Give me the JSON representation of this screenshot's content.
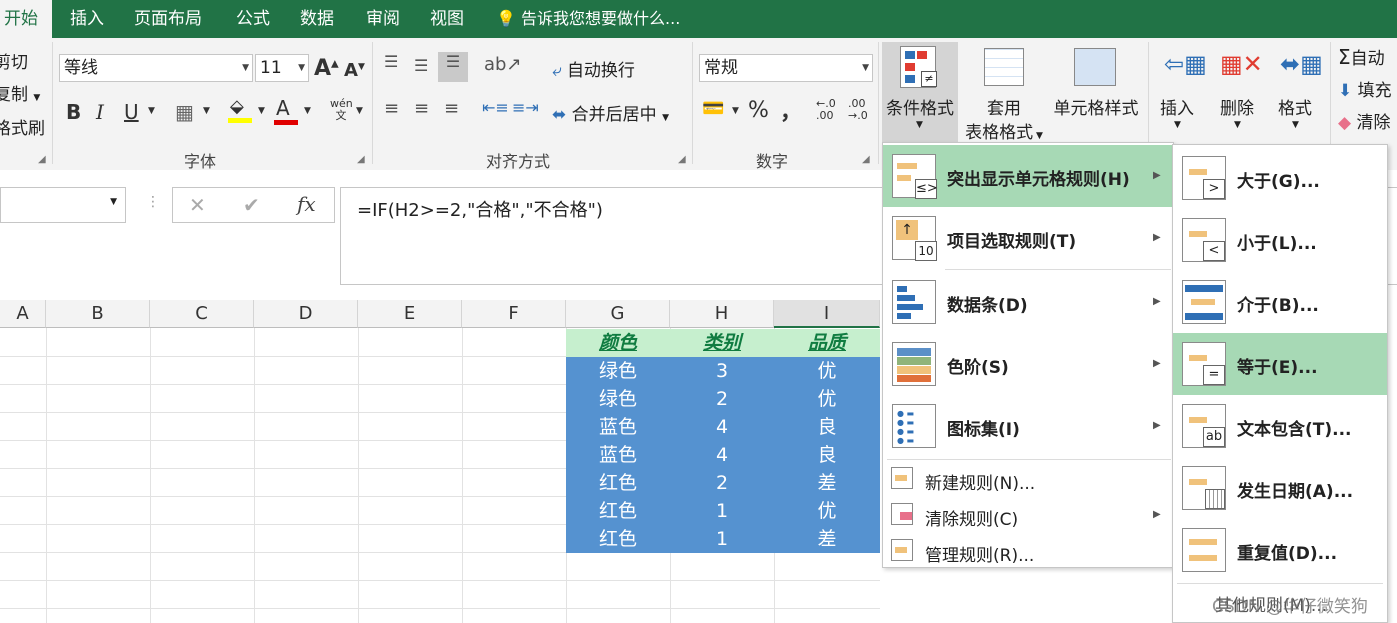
{
  "tabs": [
    {
      "label": "开始",
      "active": true
    },
    {
      "label": "插入"
    },
    {
      "label": "页面布局"
    },
    {
      "label": "公式"
    },
    {
      "label": "数据"
    },
    {
      "label": "审阅"
    },
    {
      "label": "视图"
    }
  ],
  "tell_me": "告诉我您想要做什么...",
  "clipboard": {
    "cut": "剪切",
    "copy": "复制",
    "format_painter": "格式刷"
  },
  "font": {
    "name": "等线",
    "size": "11",
    "group_label": "字体",
    "bold": "B",
    "italic": "I",
    "underline": "U",
    "grow": "A",
    "shrink": "A",
    "color_a": "A",
    "wen": "wén 文"
  },
  "alignment": {
    "wrap": "自动换行",
    "merge": "合并后居中",
    "group_label": "对齐方式"
  },
  "number": {
    "format": "常规",
    "percent": "%",
    "comma": "，",
    "group_label": "数字",
    "inc_decimal": "←.0 .00",
    "dec_decimal": ".00 →.0"
  },
  "styles": {
    "conditional": "条件格式",
    "table_format_1": "套用",
    "table_format_2": "表格格式",
    "cell_styles": "单元格样式"
  },
  "cells": {
    "insert": "插入",
    "delete": "删除",
    "format": "格式"
  },
  "editing": {
    "autosum": "自动",
    "fill": "填充",
    "clear": "清除"
  },
  "formula_bar": {
    "cancel": "✕",
    "confirm": "✔",
    "fx": "fx",
    "formula": "=IF(H2>=2,\"合格\",\"不合格\")"
  },
  "columns": [
    "A",
    "B",
    "C",
    "D",
    "E",
    "F",
    "G",
    "H",
    "I"
  ],
  "table": {
    "headers": [
      "颜色",
      "类别",
      "品质"
    ],
    "rows": [
      [
        "绿色",
        "3",
        "优"
      ],
      [
        "绿色",
        "2",
        "优"
      ],
      [
        "蓝色",
        "4",
        "良"
      ],
      [
        "蓝色",
        "4",
        "良"
      ],
      [
        "红色",
        "2",
        "差"
      ],
      [
        "红色",
        "1",
        "优"
      ],
      [
        "红色",
        "1",
        "差"
      ]
    ]
  },
  "cf_menu": {
    "items": [
      {
        "label": "突出显示单元格规则(H)"
      },
      {
        "label": "项目选取规则(T)"
      },
      {
        "label": "数据条(D)"
      },
      {
        "label": "色阶(S)"
      },
      {
        "label": "图标集(I)"
      }
    ],
    "small_items": [
      {
        "label": "新建规则(N)..."
      },
      {
        "label": "清除规则(C)"
      },
      {
        "label": "管理规则(R)..."
      }
    ],
    "top10_badge": "10"
  },
  "highlight_submenu": {
    "items": [
      {
        "label": "大于(G)...",
        "badge": ">"
      },
      {
        "label": "小于(L)...",
        "badge": "<"
      },
      {
        "label": "介于(B)...",
        "badge": ""
      },
      {
        "label": "等于(E)...",
        "badge": "="
      },
      {
        "label": "文本包含(T)...",
        "badge": "ab"
      },
      {
        "label": "发生日期(A)...",
        "badge": ""
      },
      {
        "label": "重复值(D)...",
        "badge": ""
      }
    ],
    "more": "其他规则(M)..."
  },
  "watermark": "CSDN @华仔微笑狗",
  "colors": {
    "excel_green": "#217346",
    "header_fill": "#c6efce",
    "header_font": "#107c41",
    "data_fill": "#5592d0",
    "menu_highlight": "#a7d9b5"
  }
}
